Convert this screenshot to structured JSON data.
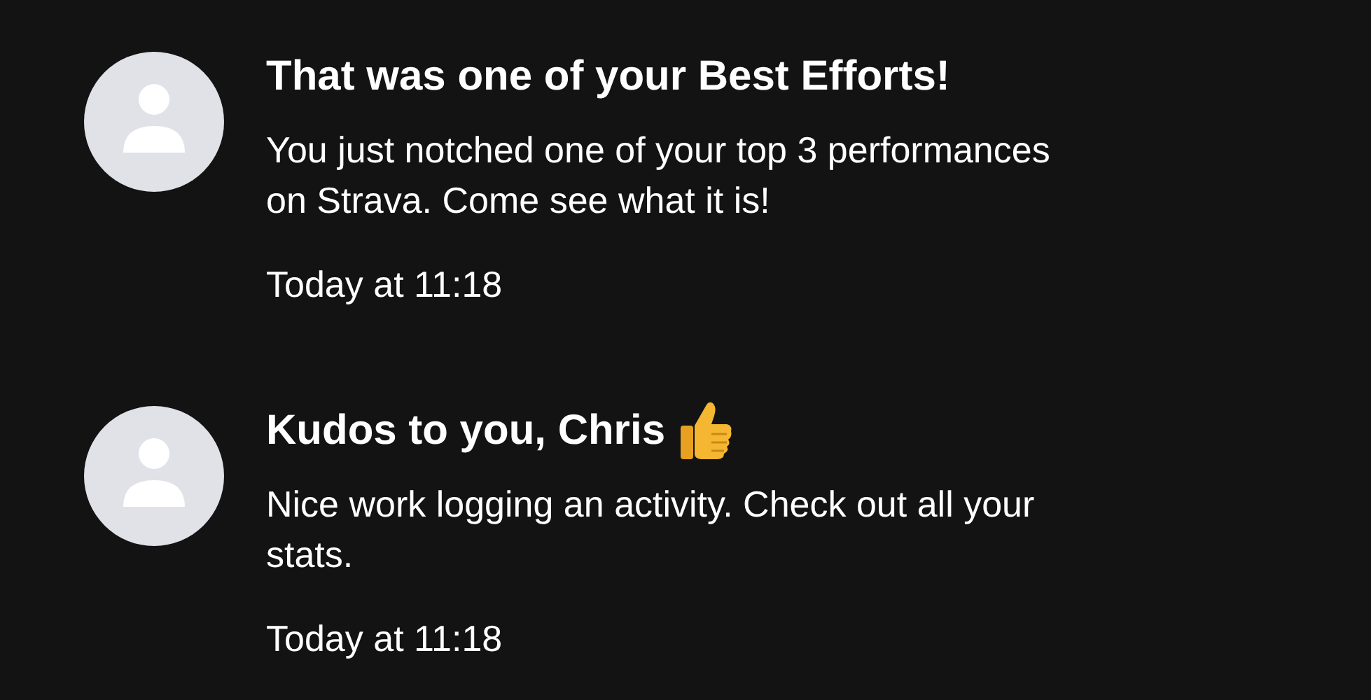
{
  "notifications": [
    {
      "title": "That was one of your Best Efforts!",
      "thumbs_up": false,
      "body": "You just notched one of your top 3 performances on Strava. Come see what it is!",
      "time": "Today at 11:18"
    },
    {
      "title": "Kudos to you, Chris",
      "thumbs_up": true,
      "body": "Nice work logging an activity. Check out all your stats.",
      "time": "Today at 11:18"
    }
  ]
}
